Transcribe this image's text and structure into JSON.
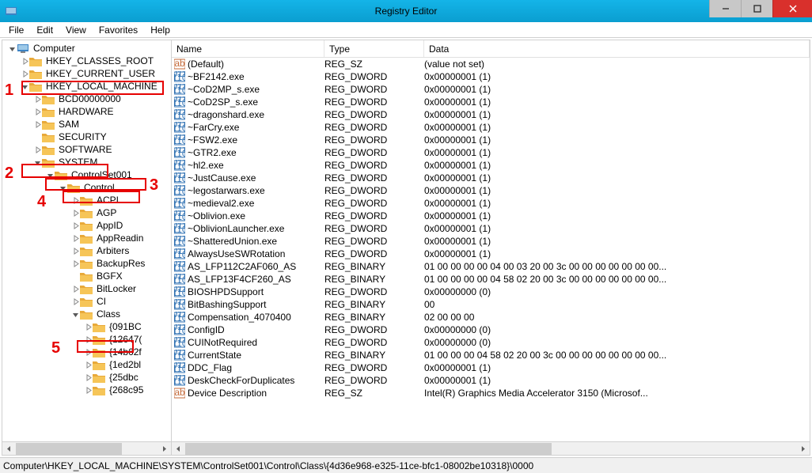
{
  "window": {
    "title": "Registry Editor"
  },
  "menu": [
    "File",
    "Edit",
    "View",
    "Favorites",
    "Help"
  ],
  "columns": {
    "name": "Name",
    "type": "Type",
    "data": "Data"
  },
  "annotations": [
    "1",
    "2",
    "3",
    "4",
    "5"
  ],
  "tree": [
    {
      "indent": 0,
      "label": "Computer",
      "exp": "open",
      "icon": "computer"
    },
    {
      "indent": 1,
      "label": "HKEY_CLASSES_ROOT",
      "exp": "closed",
      "icon": "folder"
    },
    {
      "indent": 1,
      "label": "HKEY_CURRENT_USER",
      "exp": "closed",
      "icon": "folder"
    },
    {
      "indent": 1,
      "label": "HKEY_LOCAL_MACHINE",
      "exp": "open",
      "icon": "folder"
    },
    {
      "indent": 2,
      "label": "BCD00000000",
      "exp": "closed",
      "icon": "folder"
    },
    {
      "indent": 2,
      "label": "HARDWARE",
      "exp": "closed",
      "icon": "folder"
    },
    {
      "indent": 2,
      "label": "SAM",
      "exp": "closed",
      "icon": "folder"
    },
    {
      "indent": 2,
      "label": "SECURITY",
      "exp": "none",
      "icon": "folder"
    },
    {
      "indent": 2,
      "label": "SOFTWARE",
      "exp": "closed",
      "icon": "folder"
    },
    {
      "indent": 2,
      "label": "SYSTEM",
      "exp": "open",
      "icon": "folder"
    },
    {
      "indent": 3,
      "label": "ControlSet001",
      "exp": "open",
      "icon": "folder"
    },
    {
      "indent": 4,
      "label": "Control",
      "exp": "open",
      "icon": "folder"
    },
    {
      "indent": 5,
      "label": "ACPI",
      "exp": "closed",
      "icon": "folder"
    },
    {
      "indent": 5,
      "label": "AGP",
      "exp": "closed",
      "icon": "folder"
    },
    {
      "indent": 5,
      "label": "AppID",
      "exp": "closed",
      "icon": "folder"
    },
    {
      "indent": 5,
      "label": "AppReadin",
      "exp": "closed",
      "icon": "folder"
    },
    {
      "indent": 5,
      "label": "Arbiters",
      "exp": "closed",
      "icon": "folder"
    },
    {
      "indent": 5,
      "label": "BackupRes",
      "exp": "closed",
      "icon": "folder"
    },
    {
      "indent": 5,
      "label": "BGFX",
      "exp": "none",
      "icon": "folder"
    },
    {
      "indent": 5,
      "label": "BitLocker",
      "exp": "closed",
      "icon": "folder"
    },
    {
      "indent": 5,
      "label": "CI",
      "exp": "closed",
      "icon": "folder"
    },
    {
      "indent": 5,
      "label": "Class",
      "exp": "open",
      "icon": "folder"
    },
    {
      "indent": 6,
      "label": "{091BC",
      "exp": "closed",
      "icon": "folder"
    },
    {
      "indent": 6,
      "label": "{12647(",
      "exp": "closed",
      "icon": "folder"
    },
    {
      "indent": 6,
      "label": "{14b62f",
      "exp": "closed",
      "icon": "folder"
    },
    {
      "indent": 6,
      "label": "{1ed2bl",
      "exp": "closed",
      "icon": "folder"
    },
    {
      "indent": 6,
      "label": "{25dbc",
      "exp": "closed",
      "icon": "folder"
    },
    {
      "indent": 6,
      "label": "{268c95",
      "exp": "closed",
      "icon": "folder"
    }
  ],
  "values": [
    {
      "icon": "str",
      "name": "(Default)",
      "type": "REG_SZ",
      "data": "(value not set)"
    },
    {
      "icon": "bin",
      "name": "~BF2142.exe",
      "type": "REG_DWORD",
      "data": "0x00000001 (1)"
    },
    {
      "icon": "bin",
      "name": "~CoD2MP_s.exe",
      "type": "REG_DWORD",
      "data": "0x00000001 (1)"
    },
    {
      "icon": "bin",
      "name": "~CoD2SP_s.exe",
      "type": "REG_DWORD",
      "data": "0x00000001 (1)"
    },
    {
      "icon": "bin",
      "name": "~dragonshard.exe",
      "type": "REG_DWORD",
      "data": "0x00000001 (1)"
    },
    {
      "icon": "bin",
      "name": "~FarCry.exe",
      "type": "REG_DWORD",
      "data": "0x00000001 (1)"
    },
    {
      "icon": "bin",
      "name": "~FSW2.exe",
      "type": "REG_DWORD",
      "data": "0x00000001 (1)"
    },
    {
      "icon": "bin",
      "name": "~GTR2.exe",
      "type": "REG_DWORD",
      "data": "0x00000001 (1)"
    },
    {
      "icon": "bin",
      "name": "~hl2.exe",
      "type": "REG_DWORD",
      "data": "0x00000001 (1)"
    },
    {
      "icon": "bin",
      "name": "~JustCause.exe",
      "type": "REG_DWORD",
      "data": "0x00000001 (1)"
    },
    {
      "icon": "bin",
      "name": "~legostarwars.exe",
      "type": "REG_DWORD",
      "data": "0x00000001 (1)"
    },
    {
      "icon": "bin",
      "name": "~medieval2.exe",
      "type": "REG_DWORD",
      "data": "0x00000001 (1)"
    },
    {
      "icon": "bin",
      "name": "~Oblivion.exe",
      "type": "REG_DWORD",
      "data": "0x00000001 (1)"
    },
    {
      "icon": "bin",
      "name": "~OblivionLauncher.exe",
      "type": "REG_DWORD",
      "data": "0x00000001 (1)"
    },
    {
      "icon": "bin",
      "name": "~ShatteredUnion.exe",
      "type": "REG_DWORD",
      "data": "0x00000001 (1)"
    },
    {
      "icon": "bin",
      "name": "AlwaysUseSWRotation",
      "type": "REG_DWORD",
      "data": "0x00000001 (1)"
    },
    {
      "icon": "bin",
      "name": "AS_LFP112C2AF060_AS",
      "type": "REG_BINARY",
      "data": "01 00 00 00 00 04 00 03 20 00 3c 00 00 00 00 00 00 00..."
    },
    {
      "icon": "bin",
      "name": "AS_LFP13F4CF260_AS",
      "type": "REG_BINARY",
      "data": "01 00 00 00 00 04 58 02 20 00 3c 00 00 00 00 00 00 00..."
    },
    {
      "icon": "bin",
      "name": "BIOSHPDSupport",
      "type": "REG_DWORD",
      "data": "0x00000000 (0)"
    },
    {
      "icon": "bin",
      "name": "BitBashingSupport",
      "type": "REG_BINARY",
      "data": "00"
    },
    {
      "icon": "bin",
      "name": "Compensation_4070400",
      "type": "REG_BINARY",
      "data": "02 00 00 00"
    },
    {
      "icon": "bin",
      "name": "ConfigID",
      "type": "REG_DWORD",
      "data": "0x00000000 (0)"
    },
    {
      "icon": "bin",
      "name": "CUINotRequired",
      "type": "REG_DWORD",
      "data": "0x00000000 (0)"
    },
    {
      "icon": "bin",
      "name": "CurrentState",
      "type": "REG_BINARY",
      "data": "01 00 00 00 04 58 02 20 00 3c 00 00 00 00 00 00 00 00..."
    },
    {
      "icon": "bin",
      "name": "DDC_Flag",
      "type": "REG_DWORD",
      "data": "0x00000001 (1)"
    },
    {
      "icon": "bin",
      "name": "DeskCheckForDuplicates",
      "type": "REG_DWORD",
      "data": "0x00000001 (1)"
    },
    {
      "icon": "str",
      "name": "Device Description",
      "type": "REG_SZ",
      "data": "Intel(R) Graphics Media Accelerator 3150 (Microsof..."
    }
  ],
  "statusbar": "Computer\\HKEY_LOCAL_MACHINE\\SYSTEM\\ControlSet001\\Control\\Class\\{4d36e968-e325-11ce-bfc1-08002be10318}\\0000"
}
